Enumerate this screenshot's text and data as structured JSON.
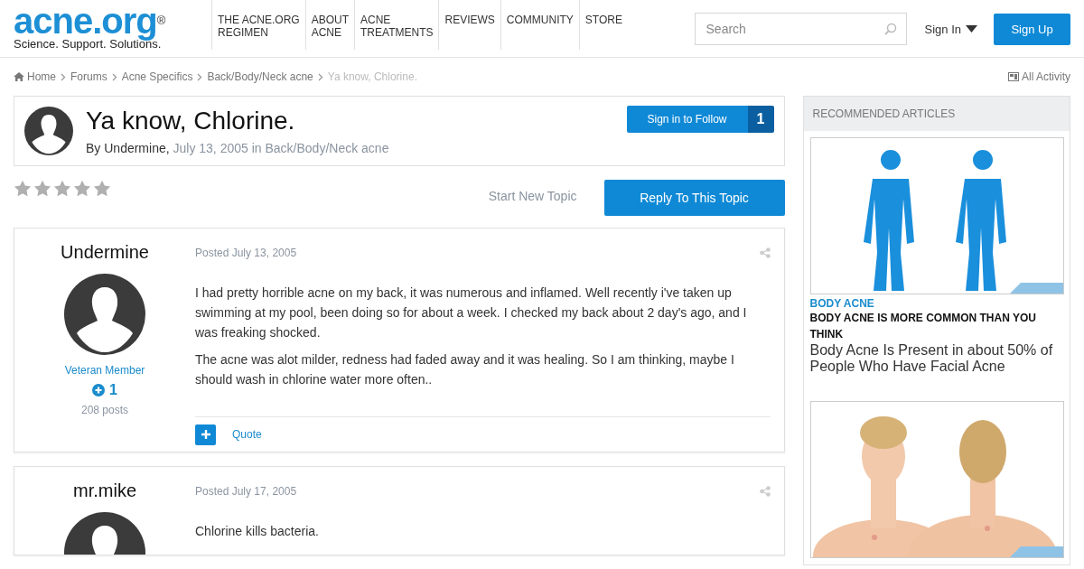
{
  "header": {
    "logo": {
      "name": "acne.org",
      "mark": "®",
      "tagline": "Science. Support. Solutions."
    },
    "nav": [
      {
        "label": "THE ACNE.ORG\nREGIMEN"
      },
      {
        "label": "ABOUT\nACNE"
      },
      {
        "label": "ACNE\nTREATMENTS"
      },
      {
        "label": "REVIEWS"
      },
      {
        "label": "COMMUNITY"
      },
      {
        "label": "STORE"
      }
    ],
    "search": {
      "placeholder": "Search"
    },
    "sign_in": "Sign In",
    "sign_up": "Sign Up"
  },
  "breadcrumb": {
    "items": [
      "Home",
      "Forums",
      "Acne Specifics",
      "Back/Body/Neck acne"
    ],
    "current": "Ya know, Chlorine.",
    "all_activity": "All Activity"
  },
  "topic": {
    "title": "Ya know, Chlorine.",
    "by": "By",
    "author": "Undermine,",
    "date": "July 13, 2005",
    "in": "in",
    "forum": "Back/Body/Neck acne",
    "follow": "Sign in to Follow",
    "followers": "1",
    "stars": 0,
    "start_new": "Start New Topic",
    "reply": "Reply To This Topic"
  },
  "posts": [
    {
      "author": "Undermine",
      "rank": "Veteran Member",
      "reputation": "1",
      "post_count": "208 posts",
      "date": "Posted July 13, 2005",
      "paragraphs": [
        "I had pretty horrible acne on my back, it was numerous and inflamed. Well recently i've taken up swimming at my pool, been doing so for about a week. I checked my back about 2 day's ago, and I was freaking shocked.",
        "The acne was alot milder, redness had faded away and it was healing. So I am thinking, maybe I should wash in chlorine water more often.."
      ],
      "quote": "Quote"
    },
    {
      "author": "mr.mike",
      "date": "Posted July 17, 2005",
      "paragraphs": [
        "Chlorine kills bacteria."
      ]
    }
  ],
  "sidebar": {
    "title": "RECOMMENDED ARTICLES",
    "articles": [
      {
        "picture": {
          "kind": "picture"
        },
        "category": "BODY ACNE",
        "headline": "BODY ACNE IS MORE COMMON THAN YOU THINK",
        "summary": "Body Acne Is Present in about 50% of People Who Have Facial Acne"
      },
      {
        "picture": {
          "kind": "picture"
        }
      }
    ]
  }
}
